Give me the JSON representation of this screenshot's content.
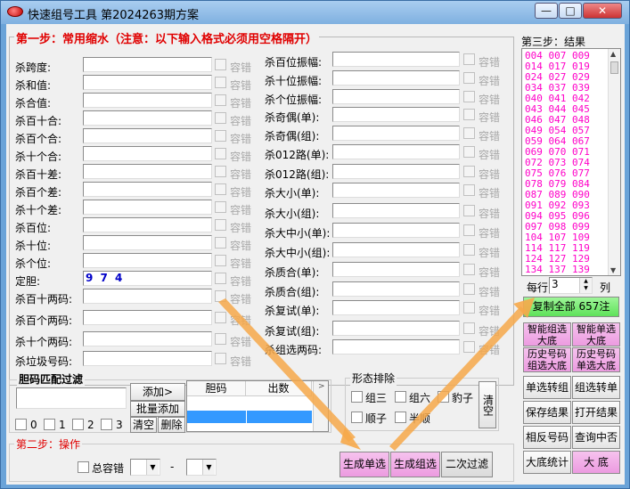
{
  "window": {
    "title": "快速组号工具   第2024263期方案",
    "min_label": "—",
    "max_label": "□",
    "close_label": "✕"
  },
  "step1": {
    "title": "第一步：常用缩水（注意：以下输入格式必须用空格隔开）",
    "tolerance_label": "容错",
    "left_rows": [
      {
        "label": "杀跨度:",
        "value": ""
      },
      {
        "label": "杀和值:",
        "value": ""
      },
      {
        "label": "杀合值:",
        "value": ""
      },
      {
        "label": "杀百十合:",
        "value": ""
      },
      {
        "label": "杀百个合:",
        "value": ""
      },
      {
        "label": "杀十个合:",
        "value": ""
      },
      {
        "label": "杀百十差:",
        "value": ""
      },
      {
        "label": "杀百个差:",
        "value": ""
      },
      {
        "label": "杀十个差:",
        "value": ""
      },
      {
        "label": "杀百位:",
        "value": ""
      },
      {
        "label": "杀十位:",
        "value": ""
      },
      {
        "label": "杀个位:",
        "value": ""
      },
      {
        "label": "定胆:",
        "value": "9 7 4"
      },
      {
        "label": "杀百十两码:",
        "value": ""
      },
      {
        "label": "杀百个两码:",
        "value": ""
      },
      {
        "label": "杀十个两码:",
        "value": ""
      },
      {
        "label": "杀垃圾号码:",
        "value": ""
      }
    ],
    "right_rows": [
      {
        "label": "杀百位振幅:",
        "value": ""
      },
      {
        "label": "杀十位振幅:",
        "value": ""
      },
      {
        "label": "杀个位振幅:",
        "value": ""
      },
      {
        "label": "杀奇偶(单):",
        "value": ""
      },
      {
        "label": "杀奇偶(组):",
        "value": ""
      },
      {
        "label": "杀012路(单):",
        "value": ""
      },
      {
        "label": "杀012路(组):",
        "value": ""
      },
      {
        "label": "杀大小(单):",
        "value": ""
      },
      {
        "label": "杀大小(组):",
        "value": ""
      },
      {
        "label": "杀大中小(单):",
        "value": ""
      },
      {
        "label": "杀大中小(组):",
        "value": ""
      },
      {
        "label": "杀质合(单):",
        "value": ""
      },
      {
        "label": "杀质合(组):",
        "value": ""
      },
      {
        "label": "杀复试(单):",
        "value": ""
      },
      {
        "label": "杀复试(组):",
        "value": ""
      },
      {
        "label": "杀组选两码:",
        "value": ""
      }
    ]
  },
  "dan_filter": {
    "title": "胆码匹配过滤",
    "add_label": "添加>",
    "batch_add_label": "批量添加",
    "clear_label": "清空",
    "delete_label": "删除",
    "col_dan": "胆码",
    "col_count": "出数",
    "checks": [
      "0",
      "1",
      "2",
      "3"
    ]
  },
  "shape_filter": {
    "title": "形态排除",
    "options": [
      "组三",
      "组六",
      "豹子",
      "顺子",
      "半顺"
    ],
    "clear_label": "清空"
  },
  "step2": {
    "title": "第二步：操作",
    "total_tol_label": "总容错",
    "dash": "-",
    "gen_single_label": "生成单选",
    "gen_group_label": "生成组选",
    "second_filter_label": "二次过滤"
  },
  "step3": {
    "title": "第三步：结果",
    "results": [
      "004 007 009",
      "014 017 019",
      "024 027 029",
      "034 037 039",
      "040 041 042",
      "043 044 045",
      "046 047 048",
      "049 054 057",
      "059 064 067",
      "069 070 071",
      "072 073 074",
      "075 076 077",
      "078 079 084",
      "087 089 090",
      "091 092 093",
      "094 095 096",
      "097 098 099",
      "104 107 109",
      "114 117 119",
      "124 127 129",
      "134 137 139"
    ],
    "per_row_label": "每行",
    "per_row_value": "3",
    "col_label": "列",
    "copy_all_label": "复制全部 657注",
    "buttons": [
      {
        "label": "智能组选\n大底",
        "pink": true
      },
      {
        "label": "智能单选\n大底",
        "pink": true
      },
      {
        "label": "历史号码\n组选大底",
        "pink": true
      },
      {
        "label": "历史号码\n单选大底",
        "pink": true
      },
      {
        "label": "单选转组",
        "pink": false
      },
      {
        "label": "组选转单",
        "pink": false
      },
      {
        "label": "保存结果",
        "pink": false
      },
      {
        "label": "打开结果",
        "pink": false
      },
      {
        "label": "相反号码",
        "pink": false
      },
      {
        "label": "查询中否",
        "pink": false
      },
      {
        "label": "大底统计",
        "pink": false
      },
      {
        "label": "大 底",
        "pink": true
      }
    ]
  }
}
